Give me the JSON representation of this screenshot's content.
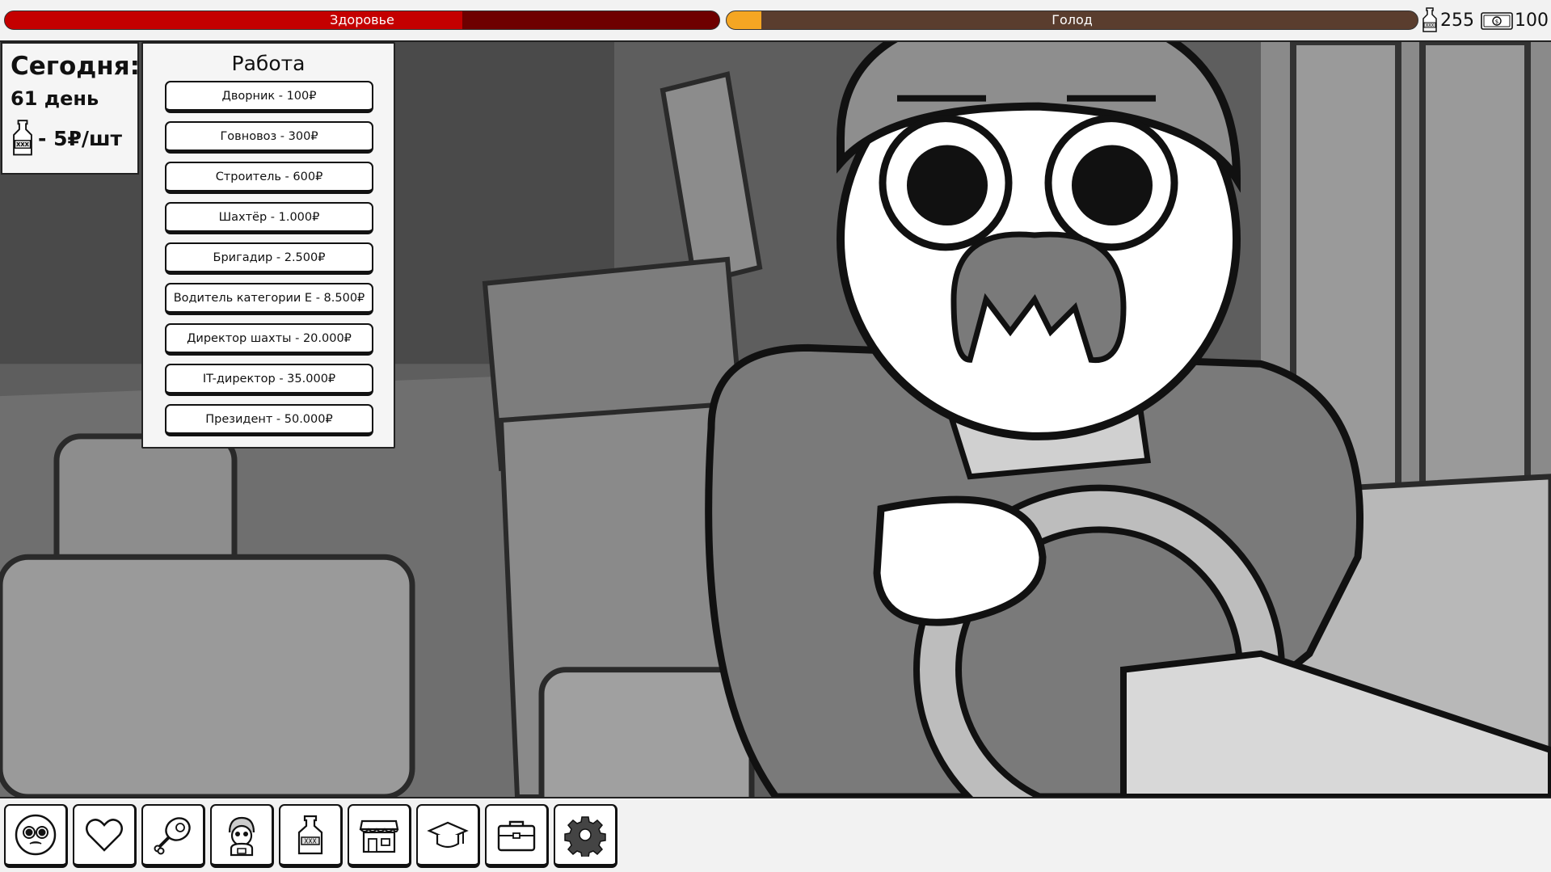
{
  "status": {
    "health": {
      "label": "Здоровье",
      "value": 0.64,
      "fill_color": "#c40000",
      "bg_color": "#6e0000"
    },
    "hunger": {
      "label": "Голод",
      "value": 0.05,
      "fill_color": "#f5a623",
      "bg_color": "#5a3d2e"
    },
    "bottles": {
      "icon": "bottle-icon",
      "count": "255"
    },
    "money": {
      "icon": "banknote-icon",
      "count": "100"
    }
  },
  "today": {
    "title": "Сегодня:",
    "day": "61 день",
    "price_icon": "bottle-icon",
    "price": "- 5₽/шт"
  },
  "work": {
    "title": "Работа",
    "jobs": [
      {
        "label": "Дворник - 100₽"
      },
      {
        "label": "Говновоз  - 300₽"
      },
      {
        "label": "Строитель  - 600₽"
      },
      {
        "label": "Шахтёр  - 1.000₽"
      },
      {
        "label": "Бригадир - 2.500₽"
      },
      {
        "label": "Водитель категории Е - 8.500₽"
      },
      {
        "label": "Директор шахты - 20.000₽"
      },
      {
        "label": "IT-директор - 35.000₽"
      },
      {
        "label": "Президент - 50.000₽"
      }
    ]
  },
  "toolbar": {
    "buttons": [
      {
        "icon": "face-icon"
      },
      {
        "icon": "heart-icon"
      },
      {
        "icon": "ham-icon"
      },
      {
        "icon": "character-icon"
      },
      {
        "icon": "bottle-icon"
      },
      {
        "icon": "shop-icon"
      },
      {
        "icon": "graduation-cap-icon"
      },
      {
        "icon": "briefcase-icon"
      },
      {
        "icon": "gear-icon"
      }
    ]
  }
}
